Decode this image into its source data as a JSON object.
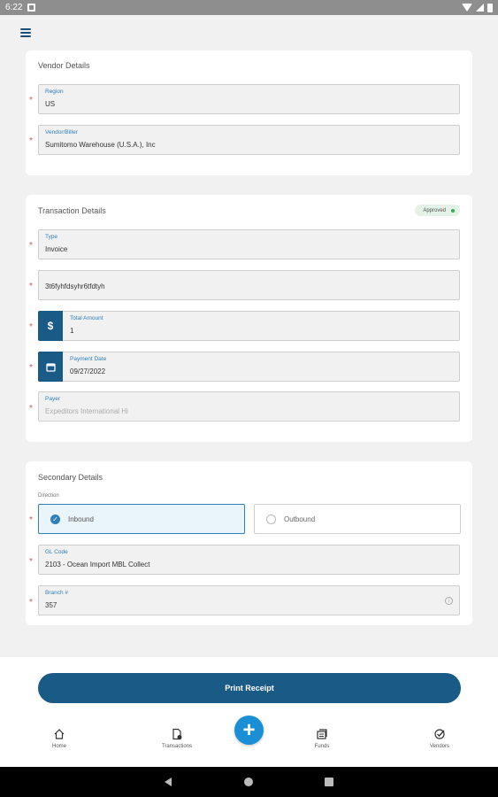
{
  "status_bar": {
    "time": "6:22"
  },
  "vendor_details": {
    "title": "Vendor Details",
    "region": {
      "label": "Region",
      "value": "US"
    },
    "vendor": {
      "label": "Vendor/Biller",
      "value": "Sumitomo Warehouse (U.S.A.), Inc"
    }
  },
  "transaction_details": {
    "title": "Transaction Details",
    "status_badge": "Approved",
    "type": {
      "label": "Type",
      "value": "Invoice"
    },
    "reference": {
      "value": "3t6fyhfdsyhr6tfdtyh"
    },
    "total_amount": {
      "label": "Total Amount",
      "value": "1",
      "icon": "dollar-icon"
    },
    "payment_date": {
      "label": "Payment Date",
      "value": "09/27/2022",
      "icon": "calendar-icon"
    },
    "payer": {
      "label": "Payer",
      "value": "Expeditors International Hi"
    }
  },
  "secondary_details": {
    "title": "Secondary Details",
    "direction_label": "Direction",
    "inbound": "Inbound",
    "outbound": "Outbound",
    "gl_code": {
      "label": "GL Code",
      "value": "2103 - Ocean Import MBL Collect"
    },
    "branch": {
      "label": "Branch #",
      "value": "357"
    }
  },
  "footer": {
    "print_receipt": "Print Receipt"
  },
  "bottom_nav": {
    "home": "Home",
    "transactions": "Transactions",
    "funds": "Funds",
    "vendors": "Vendors"
  },
  "colors": {
    "primary": "#1a5a87",
    "accent": "#2f7fb8",
    "fab": "#1a8fd6",
    "approved": "#36a852",
    "required": "#d9534f"
  }
}
